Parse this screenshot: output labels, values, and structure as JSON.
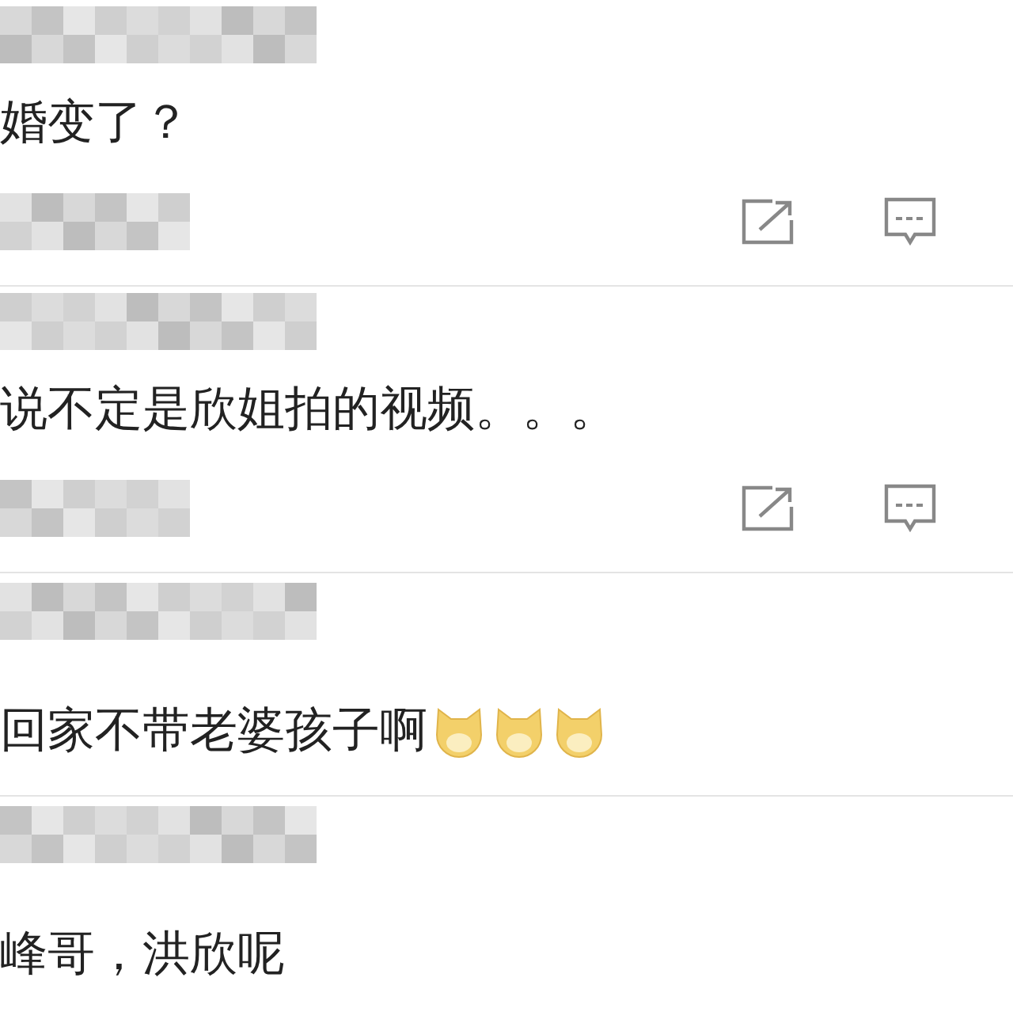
{
  "comments": [
    {
      "text": "婚变了？",
      "has_actions": true
    },
    {
      "text": "说不定是欣姐拍的视频。。。",
      "has_actions": true
    },
    {
      "text": "回家不带老婆孩子啊",
      "has_actions": false,
      "emojis": [
        {
          "kind": "dog"
        },
        {
          "kind": "dog"
        },
        {
          "kind": "dog"
        }
      ]
    },
    {
      "text": "峰哥，洪欣呢",
      "has_actions": false
    }
  ]
}
